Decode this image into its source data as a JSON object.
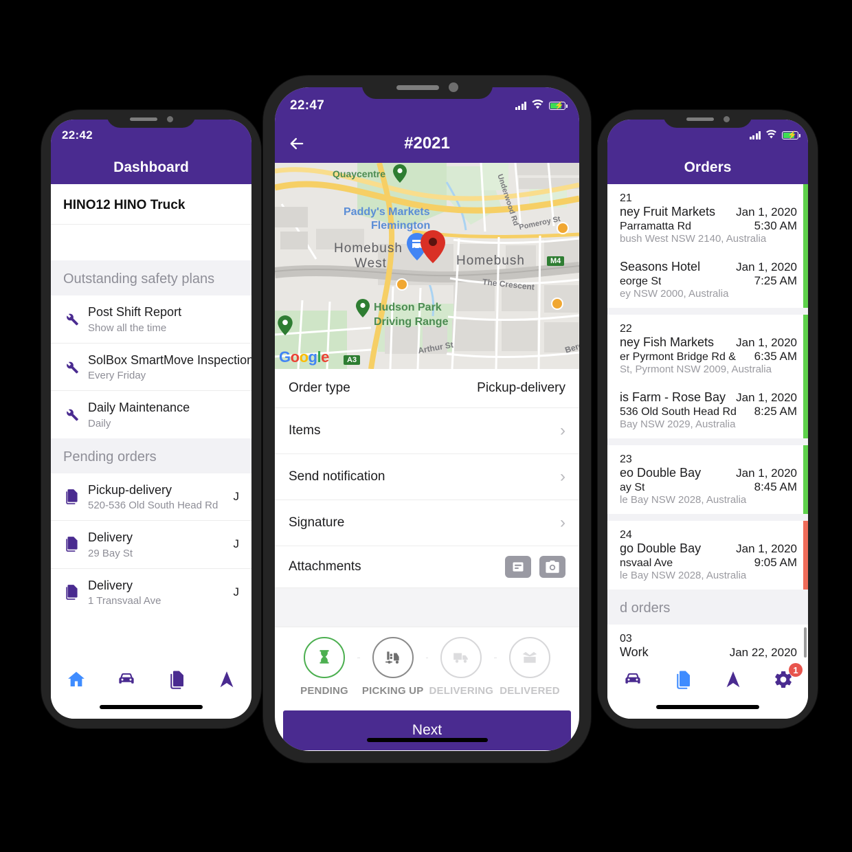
{
  "brand": {
    "purple": "#4a2b90",
    "blue": "#3f8cff",
    "green": "#4caf50",
    "red": "#e8544d",
    "grey": "#8e8e97"
  },
  "left_phone": {
    "status": {
      "time": "22:42"
    },
    "title": "Dashboard",
    "vehicle": "HINO12 HINO Truck",
    "safety_section": "Outstanding safety plans",
    "safety_plans": [
      {
        "name": "Post Shift Report",
        "schedule": "Show all the time",
        "icon": "wrench-icon"
      },
      {
        "name": "SolBox SmartMove Inspection",
        "schedule": "Every Friday",
        "icon": "wrench-icon"
      },
      {
        "name": "Daily Maintenance",
        "schedule": "Daily",
        "icon": "wrench-icon"
      }
    ],
    "orders_section": "Pending orders",
    "pending_orders": [
      {
        "type": "Pickup-delivery",
        "address": "520-536 Old South Head Rd",
        "date": "J",
        "icon": "documents-icon"
      },
      {
        "type": "Delivery",
        "address": "29 Bay St",
        "date": "J",
        "icon": "documents-icon"
      },
      {
        "type": "Delivery",
        "address": "1 Transvaal Ave",
        "date": "J",
        "icon": "documents-icon"
      }
    ],
    "tabs": [
      {
        "name": "home",
        "icon": "home-icon",
        "active": true
      },
      {
        "name": "vehicle",
        "icon": "car-icon",
        "active": false
      },
      {
        "name": "orders",
        "icon": "documents-icon",
        "active": false
      },
      {
        "name": "navigate",
        "icon": "navigation-arrow-icon",
        "active": false
      }
    ]
  },
  "center_phone": {
    "status": {
      "time": "22:47"
    },
    "title": "#2021",
    "back_icon": "back-arrow-icon",
    "map": {
      "attribution": "Google",
      "labels": [
        "Quaycentre",
        "Paddy's Markets",
        "Flemington",
        "Homebush",
        "West",
        "Homebush",
        "Underwood Rd",
        "Pomeroy St",
        "The Crescent",
        "Hudson Park",
        "Driving Range",
        "Arthur St",
        "M4",
        "A3",
        "Bere"
      ],
      "markers": [
        {
          "name": "destination-pin",
          "color": "#d93025"
        },
        {
          "name": "store-pin",
          "color": "#4285f4"
        }
      ]
    },
    "details": [
      {
        "label": "Order type",
        "value": "Pickup-delivery",
        "kind": "value"
      },
      {
        "label": "Items",
        "value": "",
        "kind": "chevron"
      },
      {
        "label": "Send notification",
        "value": "",
        "kind": "chevron"
      },
      {
        "label": "Signature",
        "value": "",
        "kind": "chevron"
      },
      {
        "label": "Attachments",
        "value": "",
        "kind": "icons"
      }
    ],
    "attachment_icons": [
      "document-icon",
      "camera-icon"
    ],
    "steps": [
      {
        "label": "PENDING",
        "icon": "hourglass-icon",
        "state": "active"
      },
      {
        "label": "PICKING UP",
        "icon": "forklift-icon",
        "state": "done"
      },
      {
        "label": "DELIVERING",
        "icon": "truck-icon",
        "state": "inactive"
      },
      {
        "label": "DELIVERED",
        "icon": "open-box-icon",
        "state": "inactive"
      }
    ],
    "next_label": "Next"
  },
  "right_phone": {
    "status": {
      "time": ""
    },
    "title": "Orders",
    "groups": [
      {
        "id": "21",
        "status_color": "#5ed14b",
        "stops": [
          {
            "name": "ney Fruit Markets",
            "addr1": "Parramatta Rd",
            "addr2": "bush West NSW 2140, Australia",
            "date": "Jan 1, 2020",
            "time": "5:30 AM"
          },
          {
            "name": "Seasons Hotel",
            "addr1": "eorge St",
            "addr2": "ey NSW 2000, Australia",
            "date": "Jan 1, 2020",
            "time": "7:25 AM"
          }
        ]
      },
      {
        "id": "22",
        "status_color": "#5ed14b",
        "stops": [
          {
            "name": "ney Fish Markets",
            "addr1": "er Pyrmont Bridge Rd &",
            "addr2": "St, Pyrmont NSW 2009, Australia",
            "date": "Jan 1, 2020",
            "time": "6:35 AM"
          },
          {
            "name": "is Farm - Rose Bay",
            "addr1": "536 Old South Head Rd",
            "addr2": "Bay NSW 2029, Australia",
            "date": "Jan 1, 2020",
            "time": "8:25 AM"
          }
        ]
      },
      {
        "id": "23",
        "status_color": "#5ed14b",
        "stops": [
          {
            "name": "eo Double Bay",
            "addr1": "ay St",
            "addr2": "le Bay NSW 2028, Australia",
            "date": "Jan 1, 2020",
            "time": "8:45 AM"
          }
        ]
      },
      {
        "id": "24",
        "status_color": "#ef6c5a",
        "stops": [
          {
            "name": "go Double Bay",
            "addr1": "nsvaal Ave",
            "addr2": "le Bay NSW 2028, Australia",
            "date": "Jan 1, 2020",
            "time": "9:05 AM"
          }
        ]
      }
    ],
    "completed_section": "d orders",
    "completed": [
      {
        "id": "03",
        "name": "Work",
        "date": "Jan 22, 2020"
      }
    ],
    "tabs": [
      {
        "name": "vehicle",
        "icon": "car-icon",
        "active": false
      },
      {
        "name": "orders",
        "icon": "documents-icon",
        "active": true
      },
      {
        "name": "navigate",
        "icon": "navigation-arrow-icon",
        "active": false
      },
      {
        "name": "settings",
        "icon": "gear-icon",
        "active": false,
        "badge": "1"
      }
    ]
  }
}
